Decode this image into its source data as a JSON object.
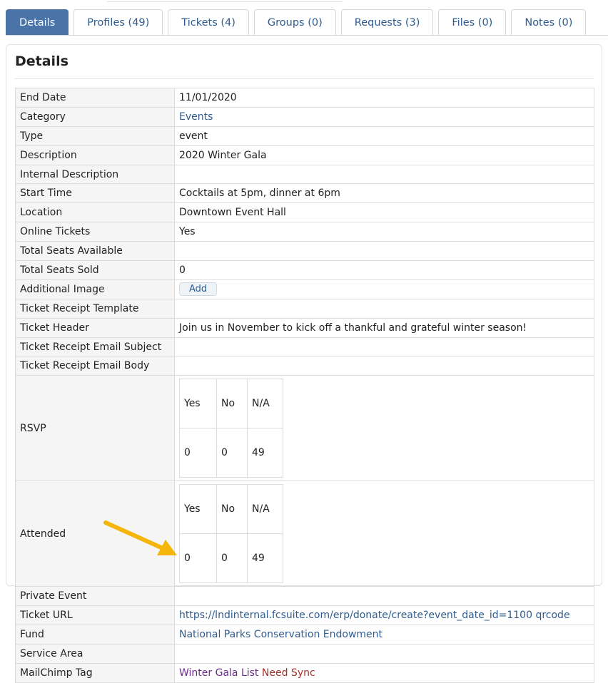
{
  "tabs": [
    {
      "label": "Details",
      "active": true
    },
    {
      "label": "Profiles (49)"
    },
    {
      "label": "Tickets (4)"
    },
    {
      "label": "Groups (0)"
    },
    {
      "label": "Requests (3)"
    },
    {
      "label": "Files (0)"
    },
    {
      "label": "Notes (0)"
    }
  ],
  "panel": {
    "title": "Details"
  },
  "rows": {
    "end_date": {
      "label": "End Date",
      "value": "11/01/2020"
    },
    "category": {
      "label": "Category",
      "value": "Events"
    },
    "type": {
      "label": "Type",
      "value": "event"
    },
    "description": {
      "label": "Description",
      "value": "2020 Winter Gala"
    },
    "internal_description": {
      "label": "Internal Description",
      "value": ""
    },
    "start_time": {
      "label": "Start Time",
      "value": "Cocktails at 5pm, dinner at 6pm"
    },
    "location": {
      "label": "Location",
      "value": "Downtown Event Hall"
    },
    "online_tickets": {
      "label": "Online Tickets",
      "value": "Yes"
    },
    "total_seats_available": {
      "label": "Total Seats Available",
      "value": ""
    },
    "total_seats_sold": {
      "label": "Total Seats Sold",
      "value": "0"
    },
    "additional_image": {
      "label": "Additional Image",
      "button": "Add"
    },
    "ticket_receipt_template": {
      "label": "Ticket Receipt Template",
      "value": ""
    },
    "ticket_header": {
      "label": "Ticket Header",
      "value": "Join us in November to kick off a thankful and grateful winter season!"
    },
    "ticket_receipt_email_subject": {
      "label": "Ticket Receipt Email Subject",
      "value": ""
    },
    "ticket_receipt_email_body": {
      "label": "Ticket Receipt Email Body",
      "value": ""
    },
    "rsvp": {
      "label": "RSVP",
      "headers": [
        "Yes",
        "No",
        "N/A"
      ],
      "values": [
        "0",
        "0",
        "49"
      ]
    },
    "attended": {
      "label": "Attended",
      "headers": [
        "Yes",
        "No",
        "N/A"
      ],
      "values": [
        "0",
        "0",
        "49"
      ]
    },
    "private_event": {
      "label": "Private Event",
      "value": ""
    },
    "ticket_url": {
      "label": "Ticket URL",
      "value": "https://lndinternal.fcsuite.com/erp/donate/create?event_date_id=1100",
      "qrcode": "qrcode"
    },
    "fund": {
      "label": "Fund",
      "value": "National Parks Conservation Endowment"
    },
    "service_area": {
      "label": "Service Area",
      "value": ""
    },
    "mailchimp_tag": {
      "label": "MailChimp Tag",
      "value": "Winter Gala List",
      "status": "Need Sync"
    }
  },
  "colors": {
    "tab_active_bg": "#4a74a8",
    "link": "#2f5c8f",
    "tag_purple": "#6b2d8c",
    "sync_red": "#a0312b",
    "annotation_arrow": "#f5b50a"
  }
}
